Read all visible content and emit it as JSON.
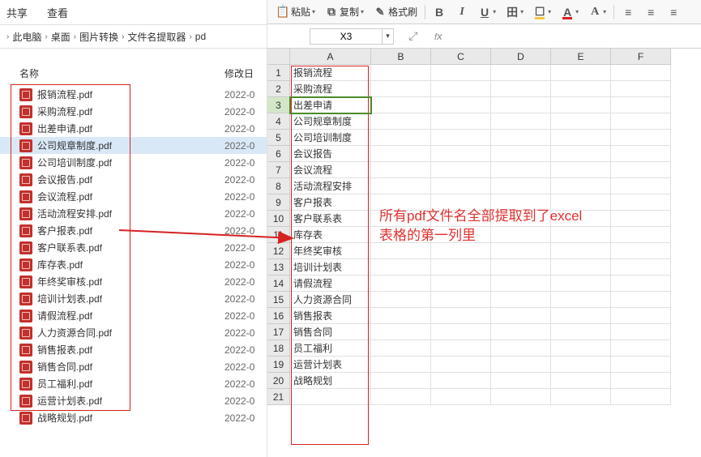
{
  "explorer": {
    "menu_share": "共享",
    "menu_view": "查看",
    "breadcrumb": [
      "此电脑",
      "桌面",
      "图片转换",
      "文件名提取器",
      "pd"
    ],
    "col_name": "名称",
    "col_date": "修改日",
    "selected_index": 3,
    "files": [
      {
        "name": "报销流程.pdf",
        "date": "2022-0"
      },
      {
        "name": "采购流程.pdf",
        "date": "2022-0"
      },
      {
        "name": "出差申请.pdf",
        "date": "2022-0"
      },
      {
        "name": "公司规章制度.pdf",
        "date": "2022-0"
      },
      {
        "name": "公司培训制度.pdf",
        "date": "2022-0"
      },
      {
        "name": "会议报告.pdf",
        "date": "2022-0"
      },
      {
        "name": "会议流程.pdf",
        "date": "2022-0"
      },
      {
        "name": "活动流程安排.pdf",
        "date": "2022-0"
      },
      {
        "name": "客户报表.pdf",
        "date": "2022-0"
      },
      {
        "name": "客户联系表.pdf",
        "date": "2022-0"
      },
      {
        "name": "库存表.pdf",
        "date": "2022-0"
      },
      {
        "name": "年终奖审核.pdf",
        "date": "2022-0"
      },
      {
        "name": "培训计划表.pdf",
        "date": "2022-0"
      },
      {
        "name": "请假流程.pdf",
        "date": "2022-0"
      },
      {
        "name": "人力资源合同.pdf",
        "date": "2022-0"
      },
      {
        "name": "销售报表.pdf",
        "date": "2022-0"
      },
      {
        "name": "销售合同.pdf",
        "date": "2022-0"
      },
      {
        "name": "员工福利.pdf",
        "date": "2022-0"
      },
      {
        "name": "运营计划表.pdf",
        "date": "2022-0"
      },
      {
        "name": "战略规划.pdf",
        "date": "2022-0"
      }
    ]
  },
  "excel": {
    "toolbar": {
      "paste": "粘贴",
      "copy": "复制",
      "format_painter": "格式刷"
    },
    "name_box": "X3",
    "fx": "fx",
    "columns": [
      "A",
      "B",
      "C",
      "D",
      "E",
      "F"
    ],
    "active_row": 3,
    "cells_a": [
      "报销流程",
      "采购流程",
      "出差申请",
      "公司规章制度",
      "公司培训制度",
      "会议报告",
      "会议流程",
      "活动流程安排",
      "客户报表",
      "客户联系表",
      "库存表",
      "年终奖审核",
      "培训计划表",
      "请假流程",
      "人力资源合同",
      "销售报表",
      "销售合同",
      "员工福利",
      "运营计划表",
      "战略规划",
      ""
    ]
  },
  "annotation": {
    "line1": "所有pdf文件名全部提取到了excel",
    "line2": "表格的第一列里"
  }
}
